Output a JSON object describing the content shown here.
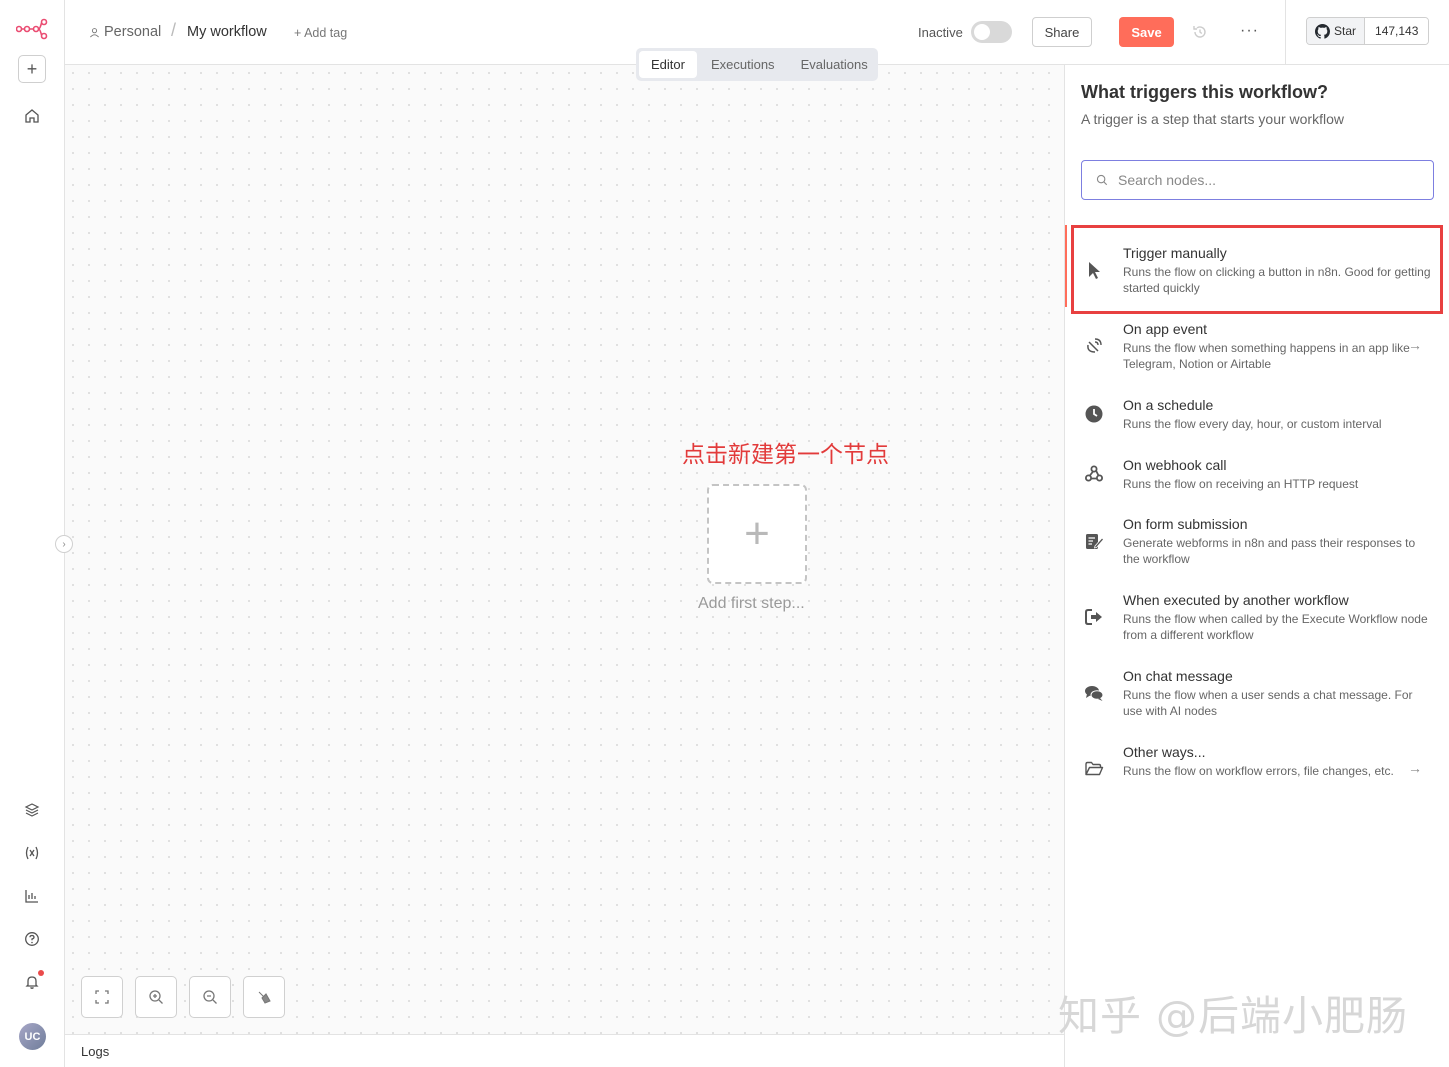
{
  "breadcrumb": {
    "project": "Personal",
    "separator": "/",
    "workflow": "My workflow",
    "add_tag": "+ Add tag"
  },
  "header": {
    "active_label": "Inactive",
    "share_label": "Share",
    "save_label": "Save",
    "more_label": "···",
    "github_star_label": "Star",
    "github_star_count": "147,143"
  },
  "tabs": [
    {
      "label": "Editor",
      "active": true
    },
    {
      "label": "Executions",
      "active": false
    },
    {
      "label": "Evaluations",
      "active": false
    }
  ],
  "canvas": {
    "annotation": "点击新建第一个节点",
    "add_first_symbol": "+",
    "add_first_label": "Add first step..."
  },
  "logs": {
    "label": "Logs"
  },
  "avatar": {
    "initials": "UC"
  },
  "panel": {
    "title": "What triggers this workflow?",
    "subtitle": "A trigger is a step that starts your workflow",
    "search_placeholder": "Search nodes...",
    "items": [
      {
        "title": "Trigger manually",
        "desc": "Runs the flow on clicking a button in n8n. Good for getting started quickly",
        "icon": "cursor-icon",
        "arrow": ""
      },
      {
        "title": "On app event",
        "desc": "Runs the flow when something happens in an app like Telegram, Notion or Airtable",
        "icon": "satellite-icon",
        "arrow": "→"
      },
      {
        "title": "On a schedule",
        "desc": "Runs the flow every day, hour, or custom interval",
        "icon": "clock-icon",
        "arrow": ""
      },
      {
        "title": "On webhook call",
        "desc": "Runs the flow on receiving an HTTP request",
        "icon": "webhook-icon",
        "arrow": ""
      },
      {
        "title": "On form submission",
        "desc": "Generate webforms in n8n and pass their responses to the workflow",
        "icon": "form-icon",
        "arrow": ""
      },
      {
        "title": "When executed by another workflow",
        "desc": "Runs the flow when called by the Execute Workflow node from a different workflow",
        "icon": "sign-in-icon",
        "arrow": ""
      },
      {
        "title": "On chat message",
        "desc": "Runs the flow when a user sends a chat message. For use with AI nodes",
        "icon": "chat-icon",
        "arrow": ""
      },
      {
        "title": "Other ways...",
        "desc": "Runs the flow on workflow errors, file changes, etc.",
        "icon": "folder-open-icon",
        "arrow": "→"
      }
    ]
  },
  "watermark": "知乎 @后端小肥肠",
  "colors": {
    "save": "#ff6d5a",
    "highlight": "#e84040",
    "annotation": "#e23b3b",
    "search_border": "#7d7fe0"
  }
}
